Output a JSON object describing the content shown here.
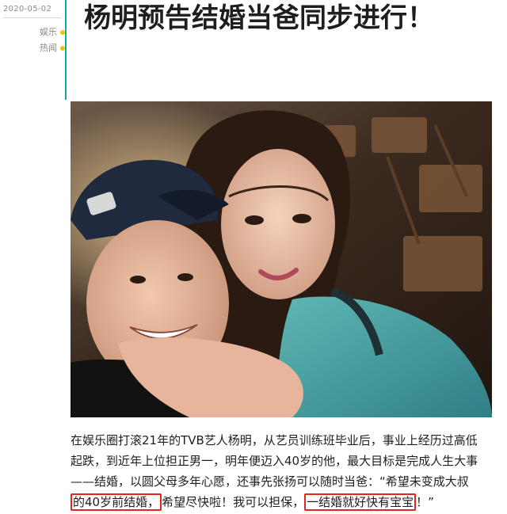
{
  "sidebar": {
    "date": "2020-05-02",
    "tags": [
      {
        "label": "娱乐",
        "color": "#f2c400"
      },
      {
        "label": "热闻",
        "color": "#f2c400"
      }
    ],
    "accent": "#1aa5a7"
  },
  "article": {
    "title": "杨明预告结婚当爸同步进行！",
    "lines": [
      {
        "parts": [
          {
            "text": "在娱乐圈打滚21年的TVB艺人杨明，从艺员训练班毕业后，事业上经历过高低",
            "hl": false
          }
        ]
      },
      {
        "parts": [
          {
            "text": "起跌，到近年上位担正男一，明年便迈入40岁的他，最大目标是完成人生大事",
            "hl": false
          }
        ]
      },
      {
        "parts": [
          {
            "text": "——结婚，以圆父母多年心愿，还事先张扬可以随时当爸：“希望未变成大叔",
            "hl": false
          }
        ]
      },
      {
        "parts": [
          {
            "text": "的40岁前结婚，",
            "hl": true
          },
          {
            "text": "希望尽快啦！我可以担保，",
            "hl": false
          },
          {
            "text": "一结婚就好快有宝宝",
            "hl": true
          },
          {
            "text": "！”",
            "hl": false
          }
        ]
      }
    ],
    "highlight_color": "#e2261c"
  }
}
